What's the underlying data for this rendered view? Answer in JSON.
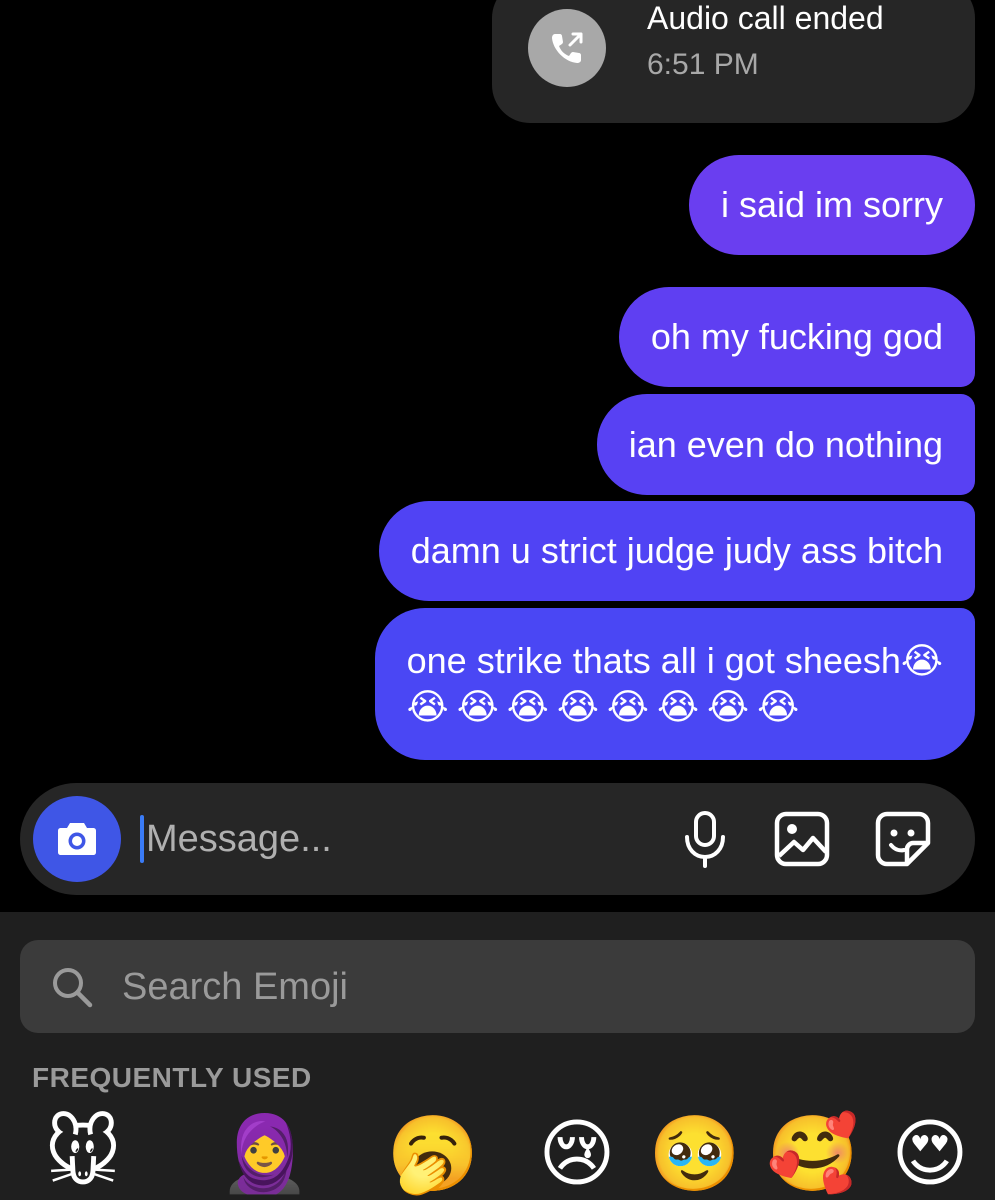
{
  "call": {
    "title": "Audio call ended",
    "time": "6:51 PM"
  },
  "messages": [
    {
      "text": "i said im sorry"
    },
    {
      "text": "oh my fucking god"
    },
    {
      "text": "ian even do nothing"
    },
    {
      "text": "damn u strict judge judy ass bitch"
    },
    {
      "text": "one strike thats all i got sheesh",
      "trailing_emoji": "😭",
      "second_line": "😭😭😭😭😭😭😭😭"
    }
  ],
  "composer": {
    "placeholder": "Message...",
    "icons": [
      "camera-icon",
      "microphone-icon",
      "gallery-icon",
      "sticker-icon"
    ],
    "camera_color": "#3f56e6"
  },
  "emoji_keyboard": {
    "search_placeholder": "Search Emoji",
    "section_label": "FREQUENTLY USED",
    "frequent": [
      {
        "name": "memoji-mouse",
        "glyph": "🐭"
      },
      {
        "name": "memoji-person-1",
        "glyph": "🧕"
      },
      {
        "name": "memoji-person-2",
        "glyph": "🥱"
      },
      {
        "name": "crying-face",
        "glyph": "😢"
      },
      {
        "name": "pleading-face",
        "glyph": "🥹"
      },
      {
        "name": "smiling-face-with-hearts",
        "glyph": "🥰"
      },
      {
        "name": "heart-eyes",
        "glyph": "😍"
      }
    ]
  },
  "colors": {
    "bubble_top": "#6a3ef0",
    "bubble_bottom": "#4a47f4",
    "background": "#000000",
    "card": "#262626"
  }
}
